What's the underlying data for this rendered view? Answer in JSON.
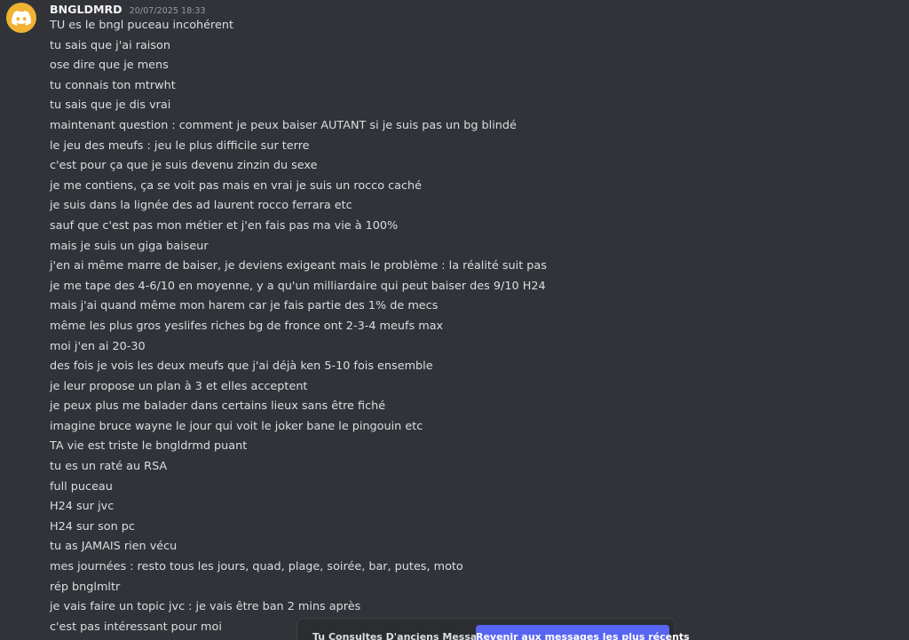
{
  "message": {
    "username": "BNGLDMRD",
    "timestamp": "20/07/2025 18:33",
    "avatar_icon": "discord-logo-icon",
    "avatar_color": "#f0b232",
    "lines": [
      "TU es le bngl puceau incohérent",
      "tu sais que j'ai raison",
      "ose dire que je mens",
      "tu connais ton mtrwht",
      "tu sais que je dis vrai",
      "maintenant question : comment je peux baiser AUTANT si je suis pas un bg blindé",
      "le jeu des meufs : jeu le plus difficile sur terre",
      "c'est pour ça que je suis devenu zinzin du sexe",
      "je me contiens, ça se voit pas mais en vrai je suis un rocco caché",
      "je suis dans la lignée des ad laurent rocco ferrara etc",
      "sauf que c'est pas mon métier et j'en fais pas ma vie à 100%",
      "mais je suis un giga baiseur",
      "j'en ai même marre de baiser, je deviens exigeant mais le problème : la réalité suit pas",
      "je me tape des 4-6/10 en moyenne, y a qu'un milliardaire qui peut baiser des 9/10 H24",
      "mais j'ai quand même mon harem car je fais partie des 1% de mecs",
      "même les plus gros yeslifes riches bg de fronce ont 2-3-4 meufs max",
      "moi j'en ai 20-30",
      "des fois je vois les deux meufs que j'ai déjà ken 5-10 fois ensemble",
      "je leur propose un plan à 3 et elles acceptent",
      "je peux plus me balader dans certains lieux sans être fiché",
      "imagine bruce wayne le jour qui voit le joker bane le pingouin etc",
      "TA vie est triste le bngldrmd puant",
      "tu es un raté au RSA",
      "full puceau",
      "H24 sur jvc",
      "H24 sur son pc",
      "tu as JAMAIS rien vécu",
      "mes journées : resto tous les jours, quad, plage, soirée, bar, putes, moto",
      "rép bnglmltr",
      "je vais faire un topic jvc : je vais être ban 2 mins après",
      "c'est pas intéressant pour moi"
    ]
  },
  "jump_bar": {
    "text": "Tu Consultes D'anciens Messages",
    "button_label": "Revenir aux messages les plus récents",
    "button_color": "#5865f2"
  }
}
